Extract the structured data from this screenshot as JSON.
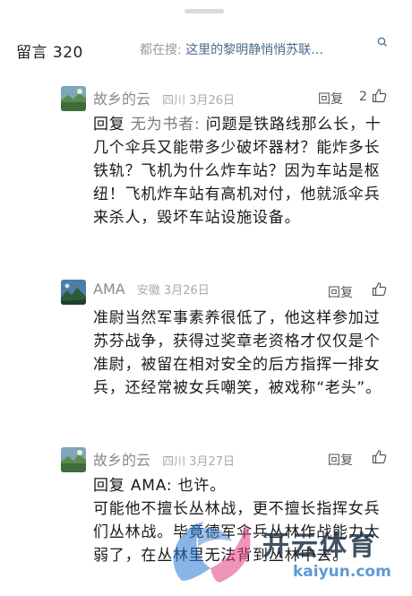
{
  "header": {
    "title": "留言 320",
    "search_prefix": "都在搜:",
    "search_query": "这里的黎明静悄悄苏联…"
  },
  "comments": [
    {
      "author": "故乡的云",
      "location_date": "四川 3月26日",
      "reply_label": "回复",
      "like_count": "2",
      "reply_prefix": "回复",
      "reply_to": "无为书者:",
      "text": "问题是铁路线那么长，十几个伞兵又能带多少破坏器材？能炸多长铁轨？飞机为什么炸车站？因为车站是枢纽！飞机炸车站有高机对付，他就派伞兵来杀人，毁坏车站设施设备。"
    },
    {
      "author": "AMA",
      "location_date": "安徽 3月26日",
      "reply_label": "回复",
      "text": "准尉当然军事素养很低了，他这样参加过苏芬战争，获得过奖章老资格才仅仅是个准尉，被留在相对安全的后方指挥一排女兵，还经常被女兵嘲笑，被戏称“老头”。"
    },
    {
      "author": "故乡的云",
      "location_date": "四川 3月27日",
      "reply_label": "回复",
      "reply_prefix": "回复",
      "reply_to": "AMA:",
      "reply_short": "也许。",
      "text": "可能他不擅长丛林战，更不擅长指挥女兵们丛林战。毕竟德军伞兵丛林作战能力太弱了，在丛林里无法背到丛林中去。"
    }
  ],
  "watermark": {
    "brand": "开云体育",
    "url": "kaiyun.com"
  },
  "colors": {
    "link_blue": "#4a6a8f",
    "meta_gray": "#8a8a8a",
    "text": "#1a1a1a"
  }
}
